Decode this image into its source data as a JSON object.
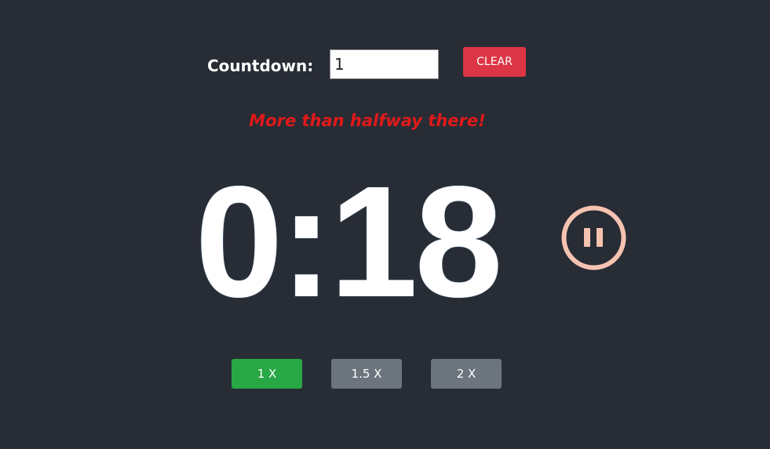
{
  "countdown": {
    "label": "Countdown:",
    "input_value": "1"
  },
  "clear_label": "CLEAR",
  "status_message": "More than halfway there!",
  "timer": {
    "display": "0:18"
  },
  "pause_icon": "pause-icon",
  "speed_buttons": [
    {
      "label": "1 X",
      "active": true
    },
    {
      "label": "1.5 X",
      "active": false
    },
    {
      "label": "2 X",
      "active": false
    }
  ],
  "colors": {
    "background": "#282c35",
    "clear": "#dc3545",
    "active_speed": "#28a745",
    "inactive_speed": "#6c757d",
    "status": "#e01a1a",
    "pause": "#f7c3b1"
  }
}
